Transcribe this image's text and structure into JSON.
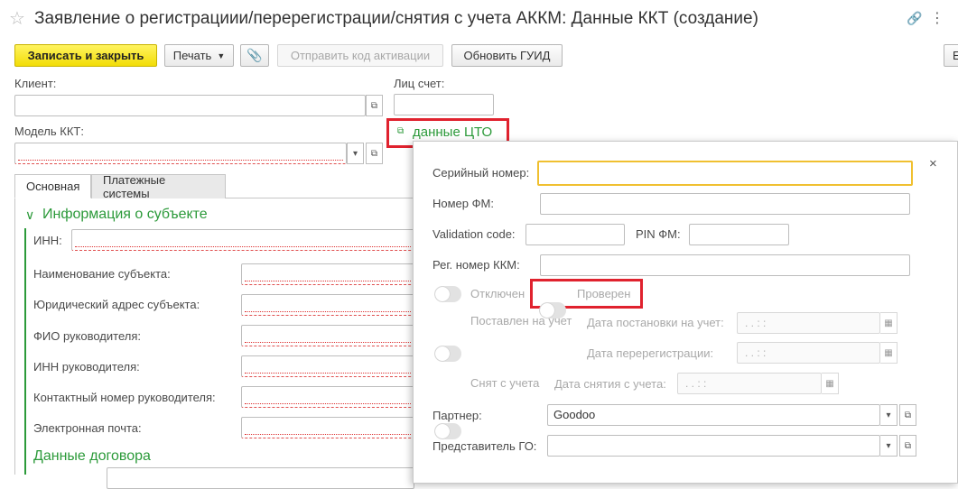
{
  "window": {
    "title": "Заявление о регистрациии/перерегистрации/снятия с учета АККМ: Данные ККТ (создание)"
  },
  "toolbar": {
    "save_close": "Записать и закрыть",
    "print": "Печать",
    "send_code": "Отправить код активации",
    "update_guid": "Обновить ГУИД",
    "more_label": "Е"
  },
  "header_fields": {
    "client_label": "Клиент:",
    "account_label": "Лиц счет:",
    "model_label": "Модель ККТ:",
    "cto_link": "данные ЦТО"
  },
  "tabs": [
    "Основная",
    "Платежные системы"
  ],
  "subject_section": {
    "title": "Информация о субъекте",
    "fields": [
      "ИНН:",
      "Наименование субъекта:",
      "Юридический адрес субъекта:",
      "ФИО руководителя:",
      "ИНН руководителя:",
      "Контактный номер руководителя:",
      "Электронная почта:"
    ]
  },
  "contract_section": {
    "title": "Данные договора"
  },
  "popup": {
    "serial_label": "Серийный номер:",
    "fm_label": "Номер ФМ:",
    "validation_label": "Validation code:",
    "pin_label": "PIN ФМ:",
    "reg_label": "Рег. номер ККМ:",
    "disabled_label": "Отключен",
    "checked_label": "Проверен",
    "registered_label": "Поставлен на учет",
    "reg_date_label": "Дата постановки на учет:",
    "rereg_date_label": "Дата перерегистрации:",
    "removed_label": "Снят с учета",
    "removed_date_label": "Дата снятия с учета:",
    "date_mask": ".  .     :  :",
    "partner_label": "Партнер:",
    "partner_value": "Goodoo",
    "rep_label": "Представитель ГО:"
  }
}
